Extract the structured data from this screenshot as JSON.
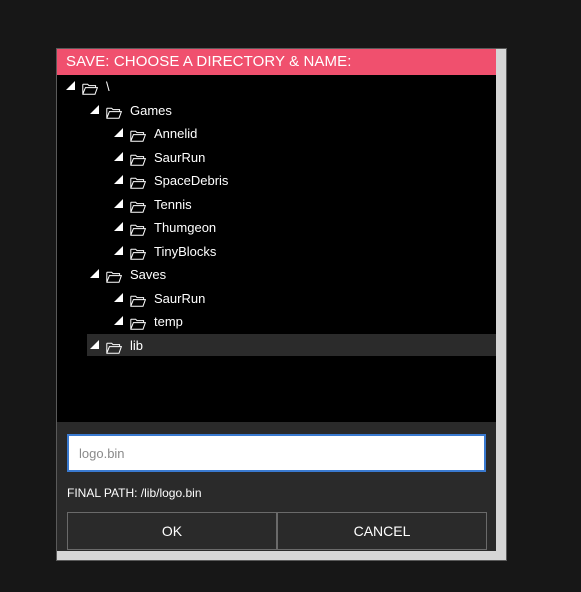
{
  "dialog": {
    "title": "SAVE: CHOOSE A DIRECTORY & NAME:",
    "accent_color": "#f0506e"
  },
  "tree": {
    "items": [
      {
        "label": "\\",
        "depth": 0,
        "selected": false
      },
      {
        "label": "Games",
        "depth": 1,
        "selected": false
      },
      {
        "label": "Annelid",
        "depth": 2,
        "selected": false
      },
      {
        "label": "SaurRun",
        "depth": 2,
        "selected": false
      },
      {
        "label": "SpaceDebris",
        "depth": 2,
        "selected": false
      },
      {
        "label": "Tennis",
        "depth": 2,
        "selected": false
      },
      {
        "label": "Thumgeon",
        "depth": 2,
        "selected": false
      },
      {
        "label": "TinyBlocks",
        "depth": 2,
        "selected": false
      },
      {
        "label": "Saves",
        "depth": 1,
        "selected": false
      },
      {
        "label": "SaurRun",
        "depth": 2,
        "selected": false
      },
      {
        "label": "temp",
        "depth": 2,
        "selected": false
      },
      {
        "label": "lib",
        "depth": 1,
        "selected": true
      }
    ],
    "expand_icon": "triangle-expanded-icon",
    "folder_icon": "folder-open-icon"
  },
  "filename": {
    "value": "logo.bin",
    "placeholder": ""
  },
  "final_path": {
    "text": "FINAL PATH: /lib/logo.bin"
  },
  "buttons": {
    "ok_label": "OK",
    "cancel_label": "CANCEL"
  }
}
